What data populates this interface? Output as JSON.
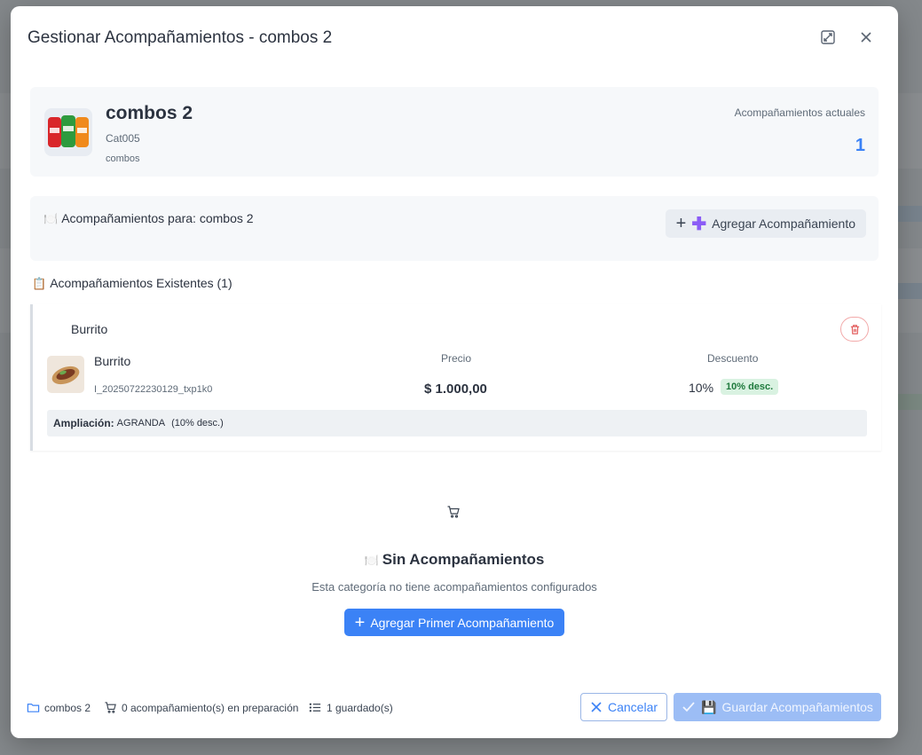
{
  "modal": {
    "title": "Gestionar Acompañamientos - combos 2"
  },
  "product": {
    "name": "combos 2",
    "code": "Cat005",
    "category": "combos",
    "count_label": "Acompañamientos actuales",
    "count_value": "1"
  },
  "for_section": {
    "emoji": "🍽️",
    "title": "Acompañamientos para: combos 2",
    "add_button": "Agregar Acompañamiento"
  },
  "existing": {
    "emoji": "📋",
    "title": "Acompañamientos Existentes (1)",
    "items": [
      {
        "title": "Burrito",
        "name": "Burrito",
        "sku": "I_20250722230129_txp1k0",
        "price_label": "Precio",
        "price": "$ 1.000,00",
        "discount_label": "Descuento",
        "discount": "10%",
        "discount_badge": "10% desc.",
        "extension_label": "Ampliación:",
        "extension_value": "AGRANDA",
        "extension_note": "(10% desc.)"
      }
    ]
  },
  "empty_state": {
    "emoji": "🍽️",
    "title": "Sin Acompañamientos",
    "subtitle": "Esta categoría no tiene acompañamientos configurados",
    "button": "Agregar Primer Acompañamiento"
  },
  "footer": {
    "category": "combos 2",
    "in_preparation": "0 acompañamiento(s) en preparación",
    "saved": "1 guardado(s)",
    "cancel": "Cancelar",
    "save": "Guardar Acompañamientos",
    "save_emoji": "💾"
  },
  "colors": {
    "primary": "#3b82f6",
    "danger": "#e05050",
    "success_bg": "#d9f2e1",
    "accent_purple": "#8b5cf6"
  },
  "icons": [
    "expand-icon",
    "close-icon",
    "plus-icon",
    "trash-icon",
    "cart-icon",
    "folder-icon",
    "list-icon",
    "check-icon"
  ]
}
